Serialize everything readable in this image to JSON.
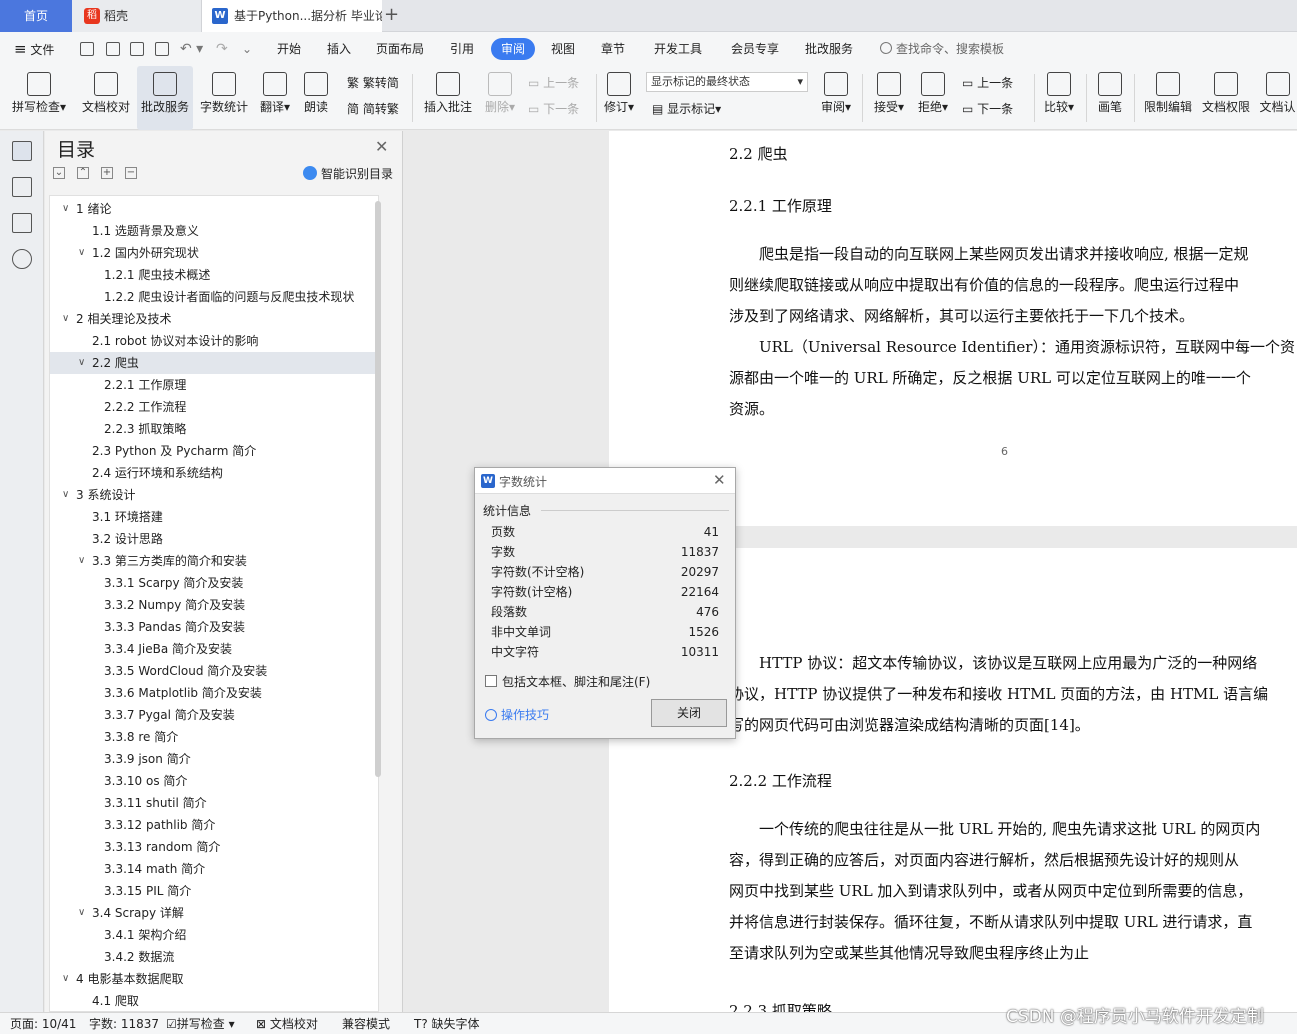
{
  "tabs": {
    "home": "首页",
    "daoke": "稻壳",
    "doc": "基于Python...据分析 毕业论",
    "new_tab": "+"
  },
  "menu": {
    "file": "文件",
    "items": [
      "开始",
      "插入",
      "页面布局",
      "引用",
      "审阅",
      "视图",
      "章节",
      "开发工具",
      "会员专享",
      "批改服务"
    ],
    "active": "审阅",
    "search": "查找命令、搜索模板"
  },
  "ribbon": {
    "spell": "拼写检查",
    "proof": "文档校对",
    "correct": "批改服务",
    "count": "字数统计",
    "translate": "翻译",
    "read": "朗读",
    "to_trad": "繁转简",
    "to_simp": "简转繁",
    "insert_comment": "插入批注",
    "delete": "删除",
    "prev_comment": "上一条",
    "next_comment": "下一条",
    "revise": "修订",
    "show_state": "显示标记的最终状态",
    "show_marks": "显示标记",
    "review": "审阅",
    "accept": "接受",
    "reject": "拒绝",
    "prev_change": "上一条",
    "next_change": "下一条",
    "compare": "比较",
    "pen": "画笔",
    "restrict": "限制编辑",
    "permission": "文档权限",
    "certify": "文档认"
  },
  "toc": {
    "title": "目录",
    "smart": "智能识别目录",
    "items": [
      {
        "label": "1  绪论",
        "arrow": true
      },
      {
        "label": "1.1  选题背景及意义"
      },
      {
        "label": "1.2  国内外研究现状",
        "arrow": true
      },
      {
        "label": "1.2.1  爬虫技术概述"
      },
      {
        "label": "1.2.2  爬虫设计者面临的问题与反爬虫技术现状"
      },
      {
        "label": "2  相关理论及技术",
        "arrow": true
      },
      {
        "label": "2.1 robot 协议对本设计的影响"
      },
      {
        "label": "2.2  爬虫",
        "arrow": true,
        "selected": true
      },
      {
        "label": "2.2.1  工作原理"
      },
      {
        "label": "2.2.2  工作流程"
      },
      {
        "label": "2.2.3  抓取策略"
      },
      {
        "label": "2.3 Python 及 Pycharm 简介"
      },
      {
        "label": "2.4 运行环境和系统结构"
      },
      {
        "label": "3  系统设计",
        "arrow": true
      },
      {
        "label": "3.1 环境搭建"
      },
      {
        "label": "3.2 设计思路"
      },
      {
        "label": "3.3  第三方类库的简介和安装",
        "arrow": true
      },
      {
        "label": "3.3.1 Scarpy 简介及安装"
      },
      {
        "label": "3.3.2 Numpy 简介及安装"
      },
      {
        "label": "3.3.3 Pandas 简介及安装"
      },
      {
        "label": "3.3.4 JieBa 简介及安装"
      },
      {
        "label": "3.3.5 WordCloud 简介及安装"
      },
      {
        "label": "3.3.6 Matplotlib 简介及安装"
      },
      {
        "label": "3.3.7 Pygal 简介及安装"
      },
      {
        "label": "3.3.8 re 简介"
      },
      {
        "label": "3.3.9 json 简介"
      },
      {
        "label": "3.3.10 os 简介"
      },
      {
        "label": "3.3.11 shutil 简介"
      },
      {
        "label": "3.3.12 pathlib 简介"
      },
      {
        "label": "3.3.13 random 简介"
      },
      {
        "label": "3.3.14 math 简介"
      },
      {
        "label": "3.3.15 PIL 简介"
      },
      {
        "label": "3.4 Scrapy 详解",
        "arrow": true
      },
      {
        "label": "3.4.1  架构介绍"
      },
      {
        "label": "3.4.2  数据流"
      },
      {
        "label": "4  电影基本数据爬取",
        "arrow": true
      },
      {
        "label": "4.1 爬取"
      }
    ]
  },
  "document": {
    "h_22": "2.2  爬虫",
    "h_221": "2.2.1  工作原理",
    "p1": [
      "爬虫是指一段自动的向互联网上某些网页发出请求并接收响应, 根据一定规",
      "则继续爬取链接或从响应中提取出有价值的信息的一段程序。爬虫运行过程中",
      "涉及到了网络请求、网络解析，其可以运行主要依托于一下几个技术。"
    ],
    "p2": [
      "URL（Universal Resource Identifier）：通用资源标识符，互联网中每一个资",
      "源都由一个唯一的 URL 所确定，反之根据 URL 可以定位互联网上的唯一一个",
      "资源。"
    ],
    "page_number": "6",
    "p3": [
      "HTTP 协议：超文本传输协议，该协议是互联网上应用最为广泛的一种网络",
      "协议，HTTP 协议提供了一种发布和接收 HTML 页面的方法，由 HTML 语言编",
      "写的网页代码可由浏览器渲染成结构清晰的页面[14]。"
    ],
    "h_222": "2.2.2  工作流程",
    "p4": [
      "一个传统的爬虫往往是从一批 URL 开始的, 爬虫先请求这批 URL 的网页内",
      "容，得到正确的应答后，对页面内容进行解析，然后根据预先设计好的规则从",
      "网页中找到某些 URL 加入到请求队列中，或者从网页中定位到所需要的信息，",
      "并将信息进行封装保存。循环往复，不断从请求队列中提取 URL 进行请求，直",
      "至请求队列为空或某些其他情况导致爬虫程序终止为止"
    ],
    "h_223": "2.2.3  抓取策略"
  },
  "dialog": {
    "title": "字数统计",
    "section": "统计信息",
    "rows": [
      {
        "label": "页数",
        "value": "41"
      },
      {
        "label": "字数",
        "value": "11837"
      },
      {
        "label": "字符数(不计空格)",
        "value": "20297"
      },
      {
        "label": "字符数(计空格)",
        "value": "22164"
      },
      {
        "label": "段落数",
        "value": "476"
      },
      {
        "label": "非中文单词",
        "value": "1526"
      },
      {
        "label": "中文字符",
        "value": "10311"
      }
    ],
    "checkbox": "包括文本框、脚注和尾注(F)",
    "tips": "操作技巧",
    "close": "关闭"
  },
  "status": {
    "page": "页面: 10/41",
    "words": "字数: 11837",
    "spell": "拼写检查",
    "proof": "文档校对",
    "compat": "兼容模式",
    "font": "缺失字体"
  },
  "watermark": "CSDN @程序员小马软件开发定制"
}
